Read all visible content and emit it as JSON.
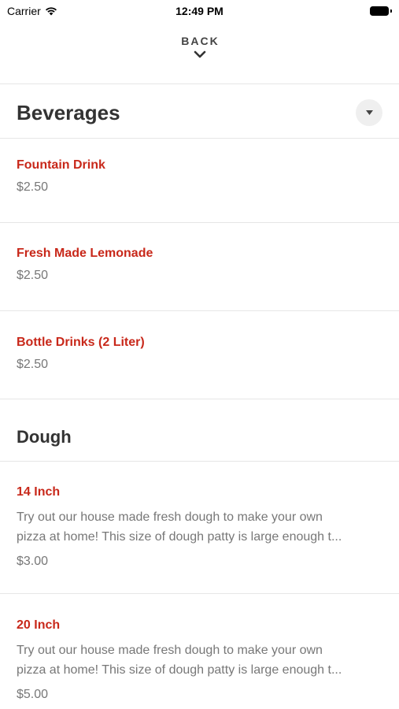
{
  "status_bar": {
    "carrier": "Carrier",
    "time": "12:49 PM"
  },
  "nav": {
    "back_label": "BACK"
  },
  "sections": [
    {
      "title": "Beverages",
      "items": [
        {
          "name": "Fountain Drink",
          "price": "$2.50"
        },
        {
          "name": "Fresh Made Lemonade",
          "price": "$2.50"
        },
        {
          "name": "Bottle Drinks (2 Liter)",
          "price": "$2.50"
        }
      ]
    },
    {
      "title": "Dough",
      "items": [
        {
          "name": "14 Inch",
          "description_line1": "Try out our house made fresh dough to make your own",
          "description_line2": "pizza at home! This size of dough patty is large enough t...",
          "price": "$3.00"
        },
        {
          "name": "20 Inch",
          "description_line1": "Try out our house made fresh dough to make your own",
          "description_line2": "pizza at home! This size of dough patty is large enough t...",
          "price": "$5.00"
        }
      ]
    }
  ],
  "colors": {
    "item_name": "#c8281a",
    "price": "#777777",
    "title": "#333333"
  },
  "icons": {
    "wifi": "wifi-icon",
    "battery": "battery-icon",
    "back": "chevron-down-icon",
    "collapse": "caret-down-icon"
  }
}
